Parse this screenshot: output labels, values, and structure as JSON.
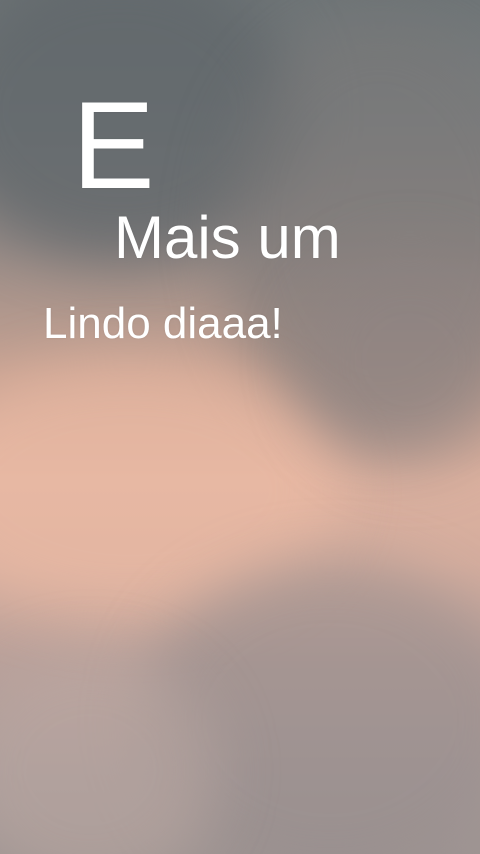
{
  "story": {
    "background": "cloudy sky photo",
    "lines": [
      {
        "text": "E"
      },
      {
        "text": "Mais um"
      },
      {
        "text": "Lindo diaaa!"
      }
    ]
  }
}
